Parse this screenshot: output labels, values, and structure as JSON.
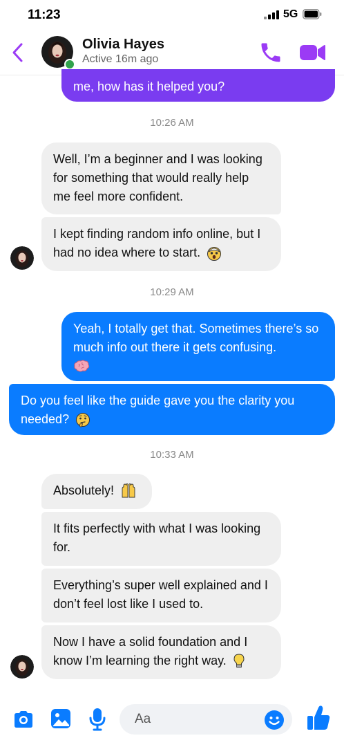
{
  "status_bar": {
    "time": "11:23",
    "network": "5G"
  },
  "header": {
    "contact_name": "Olivia Hayes",
    "contact_status": "Active 16m ago"
  },
  "thread": {
    "partial_outgoing": "me, how has it helped you?",
    "time_1": "10:26 AM",
    "in_1": "Well, I’m a beginner and I was looking for something that would really help me feel more confident.",
    "in_2": "I kept finding random info online, but I had no idea where to start.",
    "time_2": "10:29 AM",
    "out_1": "Yeah, I totally get that. Sometimes there’s so much info out there it gets confusing.",
    "out_2": "Do you feel like the guide gave you the clarity you needed?",
    "time_3": "10:33 AM",
    "in_3": "Absolutely!",
    "in_4": "It fits perfectly with what I was looking for.",
    "in_5": "Everything’s super well explained and I don’t feel lost like I used to.",
    "in_6": "Now I have a solid foundation and I know I’m learning the right way."
  },
  "composer": {
    "placeholder": "Aa"
  },
  "colors": {
    "accent_purple": "#9b3bf5",
    "outgoing_blue": "#0a7cff",
    "partial_bubble": "#7a3cf0",
    "incoming_gray": "#efefef",
    "active_green": "#31a24c",
    "composer_blue": "#0a7cff"
  },
  "icons": [
    "back-chevron-icon",
    "phone-icon",
    "video-camera-icon",
    "camera-icon",
    "gallery-icon",
    "microphone-icon",
    "emoji-smile-icon",
    "thumbs-up-icon",
    "shocked-face-emoji",
    "brain-emoji",
    "thinking-face-emoji",
    "raised-hands-emoji",
    "lightbulb-emoji"
  ]
}
